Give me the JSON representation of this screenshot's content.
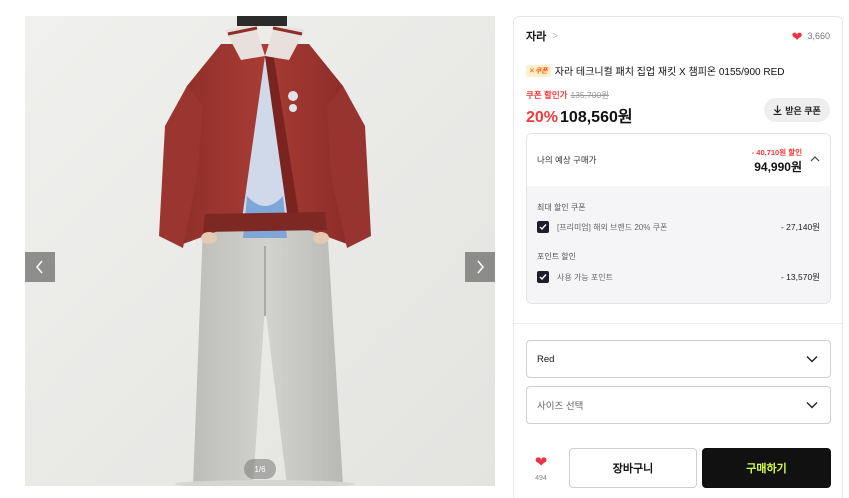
{
  "gallery": {
    "counter": "1/6",
    "prev_icon": "chevron-left-icon",
    "next_icon": "chevron-right-icon"
  },
  "product": {
    "brand": "자라",
    "brand_chevron": ">",
    "like_count": "3,660",
    "badge": "✕쿠폰",
    "title": "자라 테크니컬 패치 집업 재킷 X 챔피온 0155/900 RED",
    "coupon_price_label": "쿠폰 할인가",
    "original_price": "135,700원",
    "discount_rate": "20%",
    "sale_price": "108,560원",
    "coupon_button": "받은 쿠폰"
  },
  "estimate": {
    "label": "나의 예상 구매가",
    "discount_total": "- 40,710원 할인",
    "final_price": "94,990원",
    "coupon_section": "최대 할인 쿠폰",
    "coupon_item": "[프리미엄] 해외 브랜드 20% 쿠폰",
    "coupon_amount": "- 27,140원",
    "point_section": "포인트 할인",
    "point_item": "사용 가능 포인트",
    "point_amount": "- 13,570원"
  },
  "options": {
    "color_value": "Red",
    "size_placeholder": "사이즈 선택"
  },
  "actions": {
    "wish_count": "494",
    "cart_label": "장바구니",
    "buy_label": "구매하기"
  },
  "colors": {
    "accent_red": "#f23a3a",
    "heart": "#e8354a",
    "buy_bg": "#111111",
    "buy_text": "#d8ff47"
  }
}
